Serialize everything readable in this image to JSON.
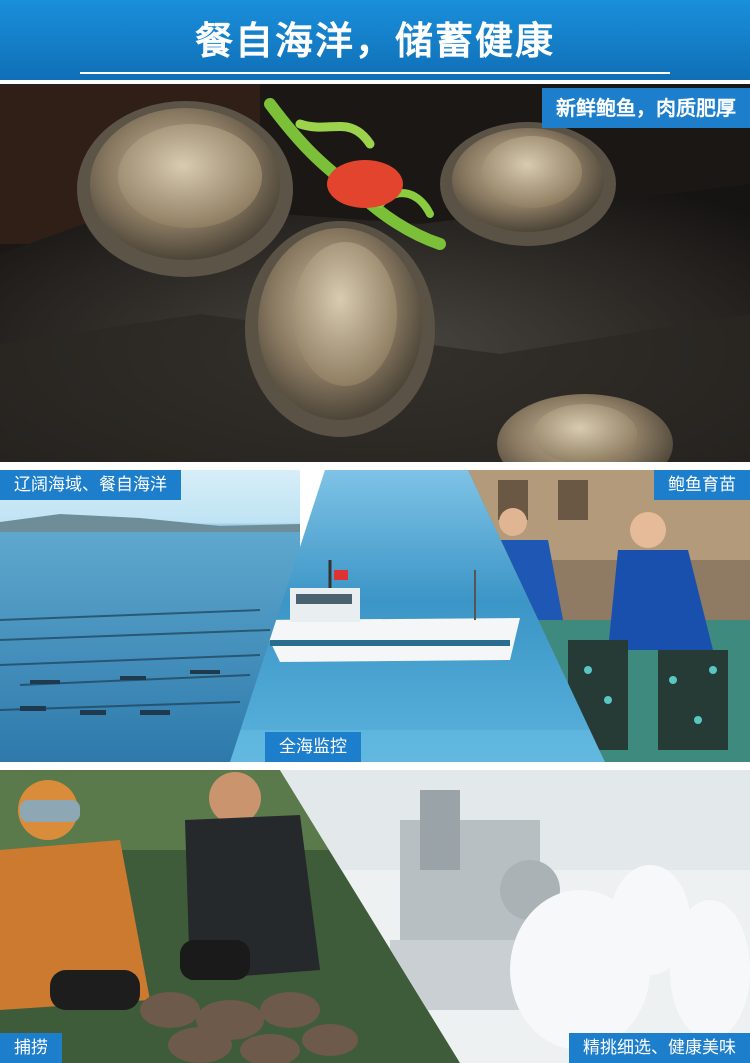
{
  "header": {
    "title": "餐自海洋，储蓄健康"
  },
  "hero": {
    "tag": "新鲜鲍鱼，肉质肥厚"
  },
  "panels": {
    "sea": {
      "tag": "辽阔海域、餐自海洋"
    },
    "monitor": {
      "tag": "全海监控"
    },
    "nursery": {
      "tag": "鲍鱼育苗"
    },
    "fishing": {
      "tag": "捕捞"
    },
    "selection": {
      "tag": "精挑细选、健康美味"
    }
  },
  "colors": {
    "brand_blue": "#1d7fcb",
    "header_top": "#1a8fdb",
    "header_bottom": "#0f6fb6"
  }
}
